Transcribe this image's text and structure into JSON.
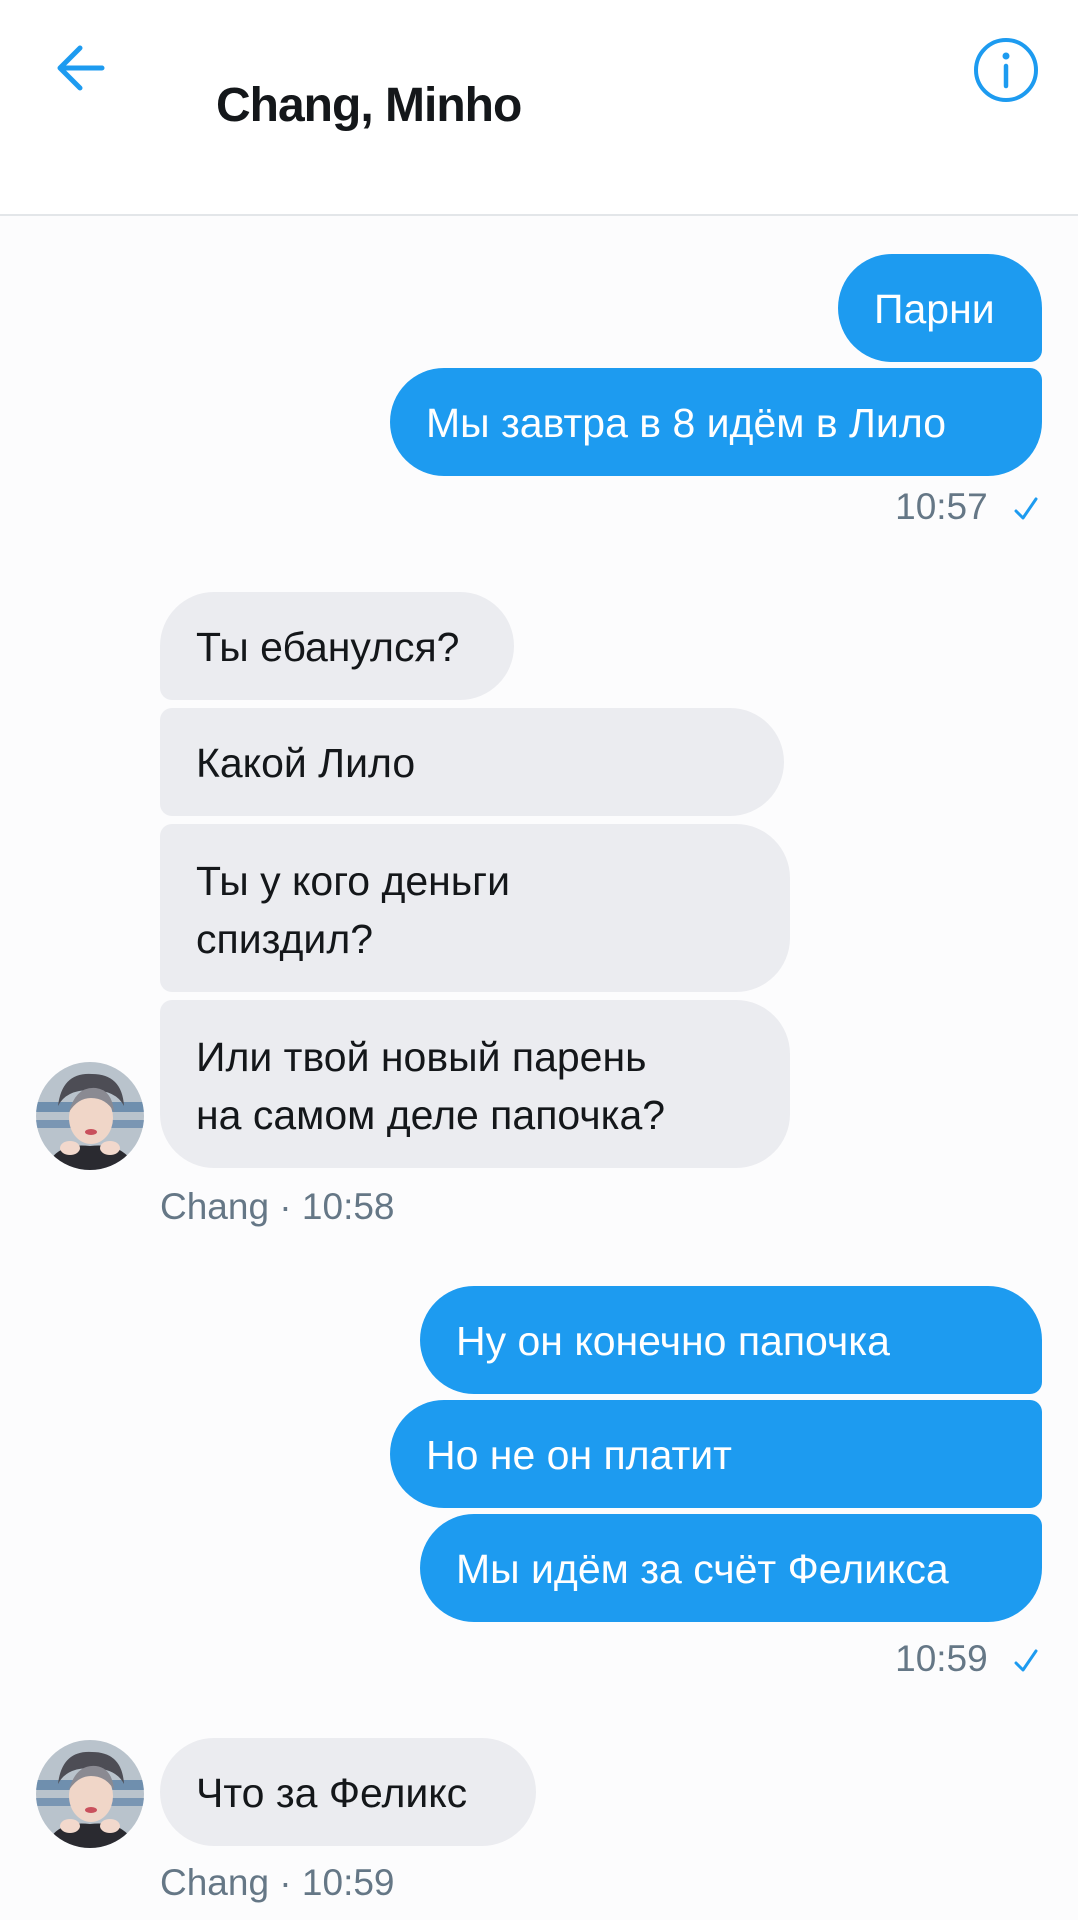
{
  "header": {
    "title": "Chang, Minho",
    "back_icon": "arrow-left-icon",
    "info_icon": "info-circle-icon",
    "accent": "#1d9bf0"
  },
  "messages": {
    "group1": {
      "m1": "Парни",
      "m2": "Мы завтра в 8 идём в Лило",
      "time": "10:57"
    },
    "group2": {
      "m1": "Ты ебанулся?",
      "m2": "Какой Лило",
      "m3_line1": "Ты у кого деньги",
      "m3_line2": "спиздил?",
      "m4_line1": "Или твой новый парень",
      "m4_line2": "на самом деле папочка?",
      "meta": "Chang · 10:58"
    },
    "group3": {
      "m1": "Ну он конечно папочка",
      "m2": "Но не он платит",
      "m3": "Мы идём за счёт Феликса",
      "time": "10:59"
    },
    "group4": {
      "m1": "Что за Феликс",
      "meta": "Chang · 10:59"
    }
  },
  "colors": {
    "outgoing_bubble": "#1d9bf0",
    "incoming_bubble": "#ebecf0",
    "meta_text": "#657786"
  }
}
